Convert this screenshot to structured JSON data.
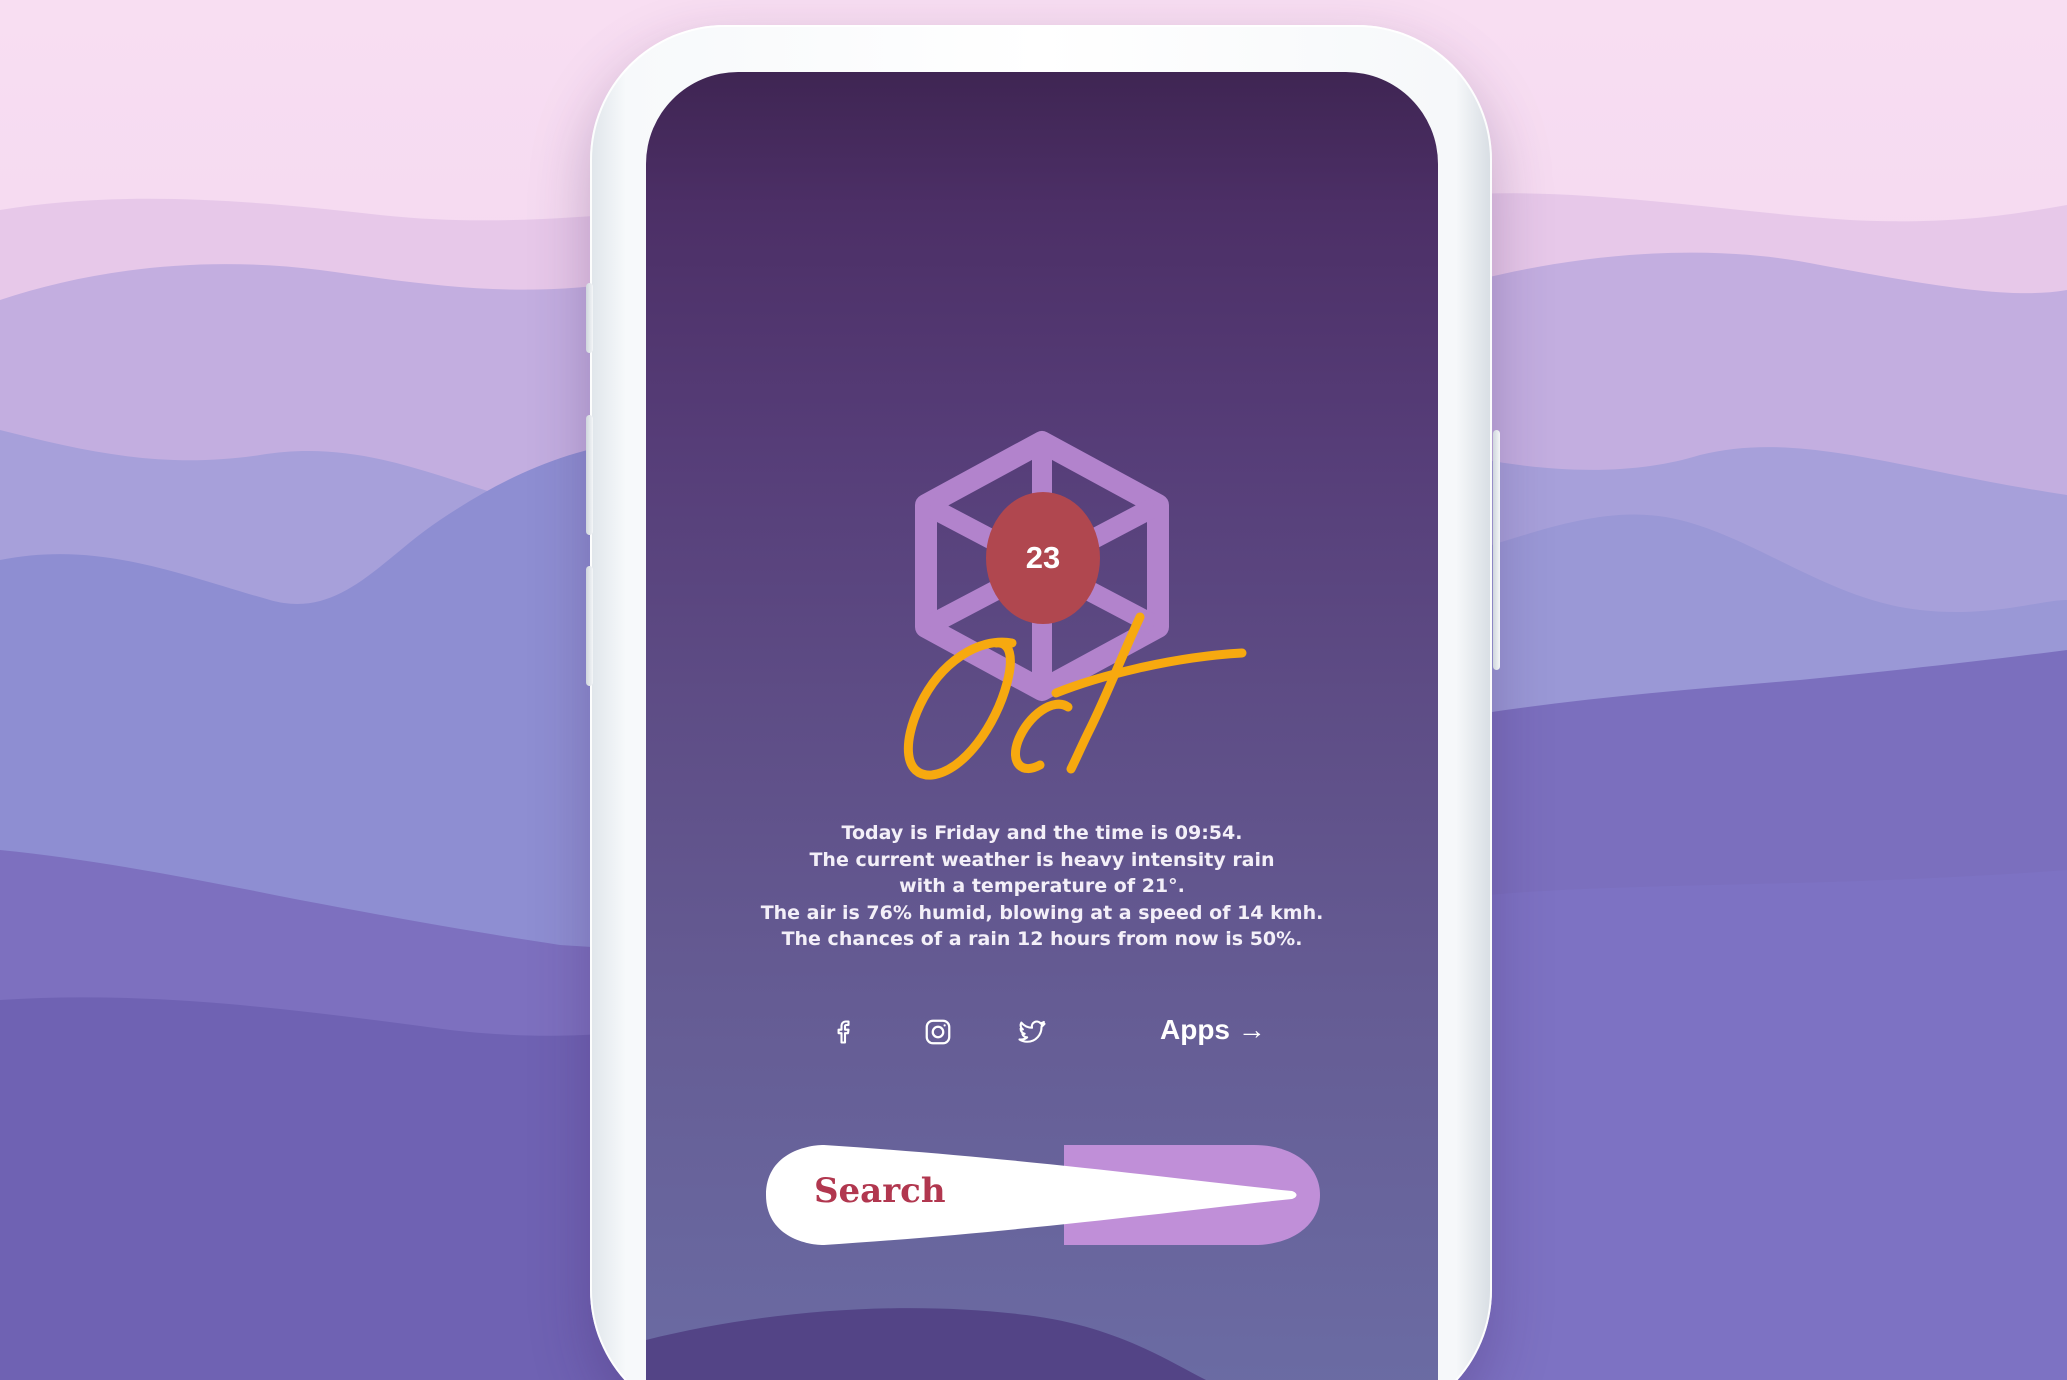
{
  "colors": {
    "screen_top": "#3f2553",
    "screen_bottom": "#6b6ca4",
    "hexagon": "#b283cc",
    "date_circle": "#b0474f",
    "month_script": "#f7a90f",
    "search_accent": "#c08fd8",
    "search_text": "#b1374f",
    "text": "#f3eff8"
  },
  "date": {
    "day": "23",
    "month": "Oct"
  },
  "weather": {
    "lines": [
      "Today is Friday and the time is 09:54.",
      "The current weather is heavy intensity rain",
      "with a temperature of 21°.",
      "The air is 76% humid, blowing at a speed of 14 kmh.",
      "The chances of a rain 12 hours from now is 50%."
    ]
  },
  "social": [
    {
      "icon": "facebook-icon"
    },
    {
      "icon": "instagram-icon"
    },
    {
      "icon": "twitter-icon"
    }
  ],
  "apps_link": {
    "label": "Apps →"
  },
  "search": {
    "placeholder": "Search"
  }
}
